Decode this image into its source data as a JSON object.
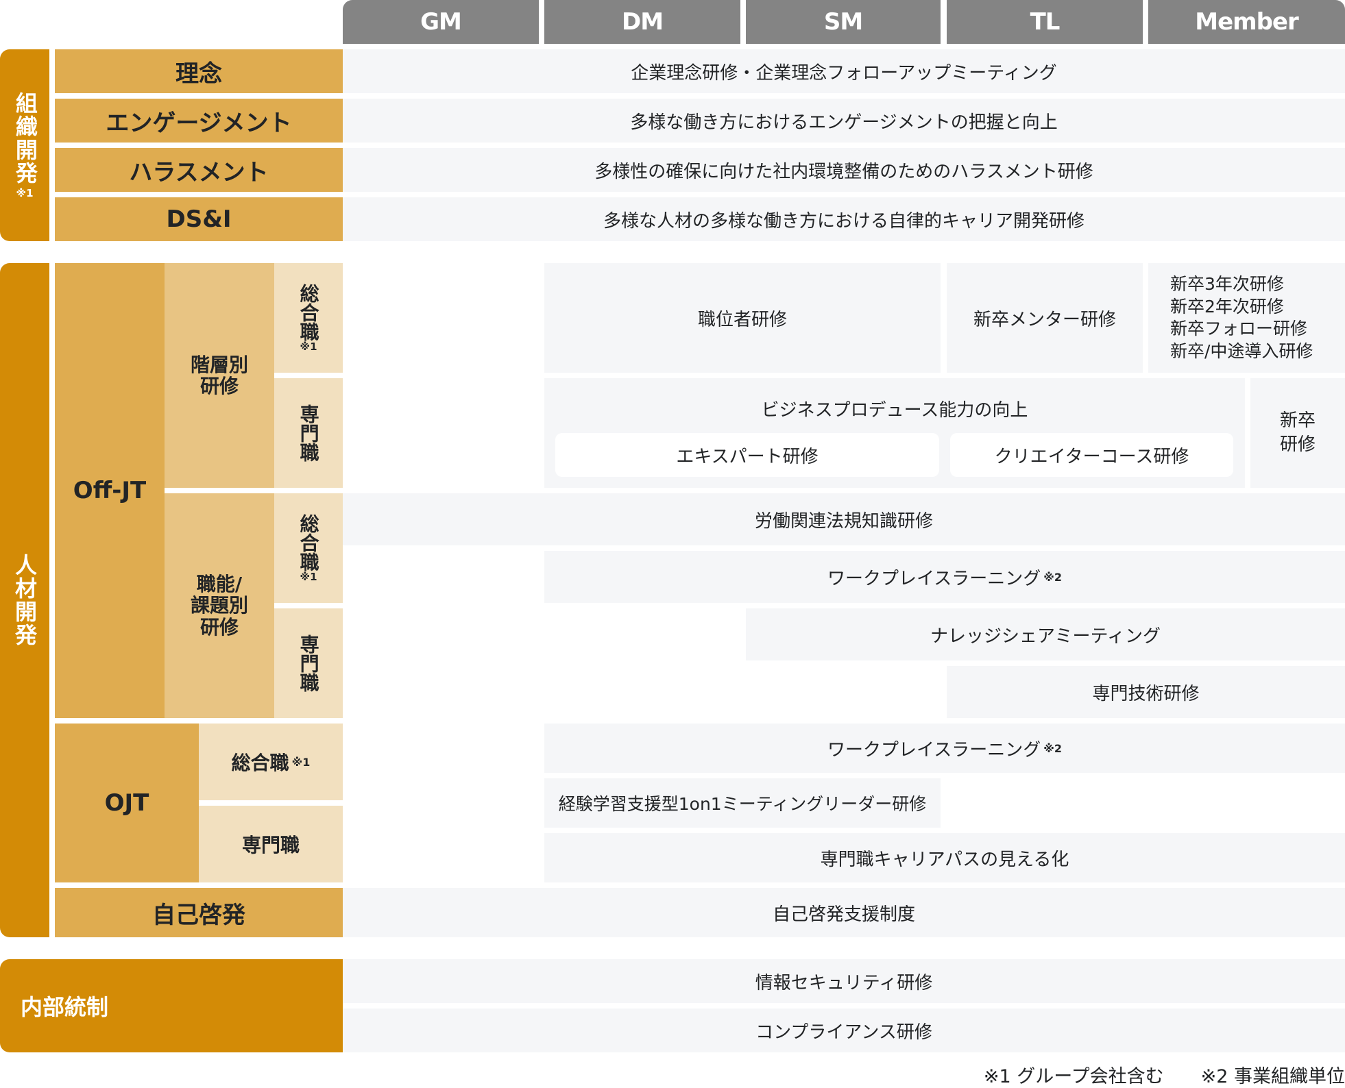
{
  "header": {
    "columns": [
      "GM",
      "DM",
      "SM",
      "TL",
      "Member"
    ]
  },
  "colors": {
    "category_dark": "#d38b06",
    "category_mid": "#dfac50",
    "category_light": "#e8c483",
    "category_pale": "#f2e0bf",
    "cell_bg": "#f5f6f8",
    "header_bg": "#848484"
  },
  "org_dev": {
    "label": "組織開発",
    "note": "※1",
    "rows": [
      {
        "label": "理念",
        "content": "企業理念研修・企業理念フォローアップミーティング"
      },
      {
        "label": "エンゲージメント",
        "content": "多様な働き方におけるエンゲージメントの把握と向上"
      },
      {
        "label": "ハラスメント",
        "content": "多様性の確保に向けた社内環境整備のためのハラスメント研修"
      },
      {
        "label": "DS&I",
        "content": "多様な人材の多様な働き方における自律的キャリア開発研修"
      }
    ]
  },
  "hr_dev": {
    "label": "人材開発",
    "off_jt": {
      "label": "Off-JT",
      "hierarchy": {
        "label_line1": "階層別",
        "label_line2": "研修",
        "general": {
          "label": "総合職",
          "note": "※1"
        },
        "specialist": {
          "label": "専門職"
        },
        "position_training": "職位者研修",
        "mentor_training": "新卒メンター研修",
        "newgrad_list": [
          "新卒3年次研修",
          "新卒2年次研修",
          "新卒フォロー研修",
          "新卒/中途導入研修"
        ],
        "business_produce": "ビジネスプロデュース能力の向上",
        "expert_training": "エキスパート研修",
        "creator_training": "クリエイターコース研修",
        "newgrad_training_line1": "新卒",
        "newgrad_training_line2": "研修"
      },
      "function": {
        "label_line1": "職能/",
        "label_line2": "課題別",
        "label_line3": "研修",
        "general": {
          "label": "総合職",
          "note": "※1"
        },
        "specialist": {
          "label": "専門職"
        },
        "labor_law": "労働関連法規知識研修",
        "workplace_learning": "ワークプレイスラーニング",
        "workplace_note": "※2",
        "knowledge_share": "ナレッジシェアミーティング",
        "tech_training": "専門技術研修"
      }
    },
    "ojt": {
      "label": "OJT",
      "general": {
        "label": "総合職",
        "note": "※1"
      },
      "specialist": {
        "label": "専門職"
      },
      "workplace_learning": "ワークプレイスラーニング",
      "workplace_note": "※2",
      "one_on_one": "経験学習支援型1on1ミーティングリーダー研修",
      "career_path": "専門職キャリアパスの見える化"
    },
    "self_dev": {
      "label": "自己啓発",
      "content": "自己啓発支援制度"
    }
  },
  "internal_control": {
    "label": "内部統制",
    "rows": [
      "情報セキュリティ研修",
      "コンプライアンス研修"
    ]
  },
  "footnotes": [
    "※1 グループ会社含む",
    "※2 事業組織単位"
  ]
}
